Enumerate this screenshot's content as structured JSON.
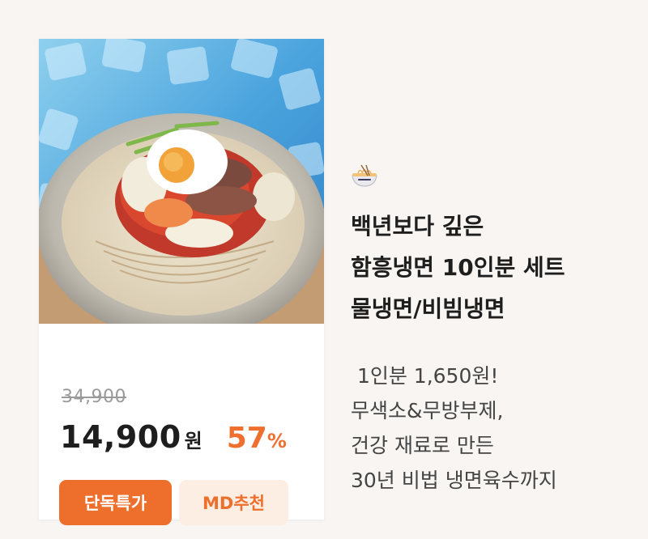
{
  "product": {
    "image_alt": "냉면 이미지",
    "original_price": "34,900",
    "price": "14,900",
    "currency": "원",
    "discount_value": "57",
    "discount_unit": "%",
    "badges": [
      "단독특가",
      "MD추천"
    ]
  },
  "promo": {
    "emoji": "noodle-bowl-emoji",
    "title_lines": [
      "백년보다 깊은",
      "함흥냉면 10인분 세트",
      "물냉면/비빔냉면"
    ],
    "description_lines": [
      " 1인분 1,650원!",
      "무색소&무방부제,",
      "건강 재료로 만든",
      "30년 비법 냉면육수까지"
    ]
  },
  "colors": {
    "accent": "#ee6f2c",
    "accent_light": "#fdeee4",
    "background": "#f8f5f2",
    "text": "#1e1e1e"
  }
}
